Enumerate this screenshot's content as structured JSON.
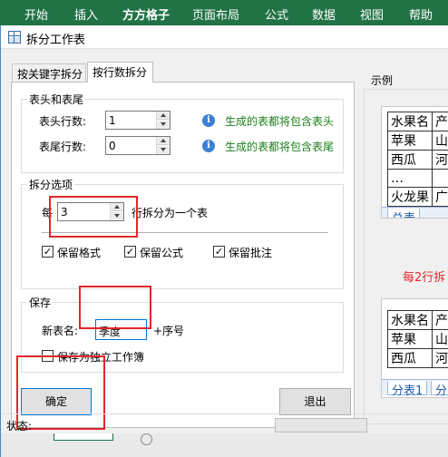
{
  "ribbon": {
    "tabs": [
      "开始",
      "插入",
      "方方格子",
      "页面布局",
      "公式",
      "数据",
      "视图",
      "帮助"
    ]
  },
  "dialog": {
    "title": "拆分工作表",
    "tabs": [
      "按关键字拆分",
      "按行数拆分"
    ],
    "active_tab": "按行数拆分",
    "header_footer": {
      "title": "表头和表尾",
      "header_label": "表头行数:",
      "header_value": "1",
      "footer_label": "表尾行数:",
      "footer_value": "0",
      "header_info": "生成的表都将包含表头",
      "footer_info": "生成的表都将包含表尾"
    },
    "split_options": {
      "title": "拆分选项",
      "prefix": "每",
      "rows_value": "3",
      "suffix": "行拆分为一个表",
      "keep_format": "保留格式",
      "keep_formula": "保留公式",
      "keep_comment": "保留批注",
      "keep_format_checked": true,
      "keep_formula_checked": true,
      "keep_comment_checked": true
    },
    "save": {
      "title": "保存",
      "new_name_label": "新表名:",
      "new_name_value": "季度",
      "suffix": "+序号",
      "standalone_label": "保存为独立工作簿",
      "standalone_checked": false
    },
    "buttons": {
      "ok": "确定",
      "exit": "退出"
    },
    "example": {
      "title": "示例",
      "sheet1_header": [
        "水果名",
        "产"
      ],
      "sheet1_rows": [
        [
          "苹果",
          "山"
        ],
        [
          "西瓜",
          "河"
        ],
        [
          "…",
          ""
        ],
        [
          "火龙果",
          "广"
        ]
      ],
      "sheet1_tab": "总表",
      "caption": "每2行拆",
      "sheet2_header": [
        "水果名",
        "产"
      ],
      "sheet2_rows": [
        [
          "苹果",
          "山"
        ],
        [
          "西瓜",
          "河"
        ]
      ],
      "sheet2_tab": "分表1",
      "sheet2_tab2": "分"
    },
    "status": {
      "label": "状态:"
    }
  },
  "colors": {
    "ribbon": "#217346",
    "highlight": "#e3262b",
    "info_text": "#1a7d1a",
    "accent": "#0078d7"
  }
}
